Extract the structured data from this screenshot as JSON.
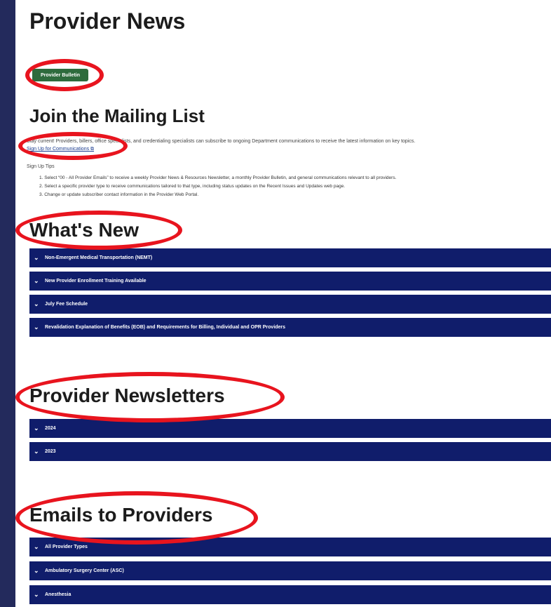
{
  "page_title": "Provider News",
  "bulletin_button": "Provider Bulletin",
  "mailing": {
    "heading": "Join the Mailing List",
    "intro": "Stay current! Providers, billers, office specialists, and credentialing specialists can subscribe to ongoing Department communications to receive the latest information on key topics.",
    "signup_link": "Sign Up for Communications",
    "external_mark": "⧉",
    "steps_label": "Sign Up Tips",
    "steps": [
      "1. Select “00 - All Provider Emails” to receive a weekly Provider News & Resources Newsletter, a monthly Provider Bulletin, and general communications relevant to all providers.",
      "2. Select a specific provider type to receive communications tailored to that type, including status updates on the Recent Issues and Updates web page.",
      "3. Change or update subscriber contact information in the Provider Web Portal."
    ]
  },
  "whats_new": {
    "heading": "What's New",
    "items": [
      "Non-Emergent Medical Transportation (NEMT)",
      "New Provider Enrollment Training Available",
      "July Fee Schedule",
      "Revalidation Explanation of Benefits (EOB) and Requirements for Billing, Individual and OPR Providers"
    ]
  },
  "newsletters": {
    "heading": "Provider Newsletters",
    "items": [
      "2024",
      "2023"
    ]
  },
  "emails": {
    "heading": "Emails to Providers",
    "items": [
      "All Provider Types",
      "Ambulatory Surgery Center (ASC)",
      "Anesthesia"
    ]
  },
  "colors": {
    "sidebar_bg": "#232a5c",
    "accordion_bg": "#101d6b",
    "button_bg": "#2e6b3d",
    "annotation_ring": "#e8141e"
  },
  "icons": {
    "accordion_chevron": "chevron-down-icon",
    "external_link": "external-link-icon"
  }
}
